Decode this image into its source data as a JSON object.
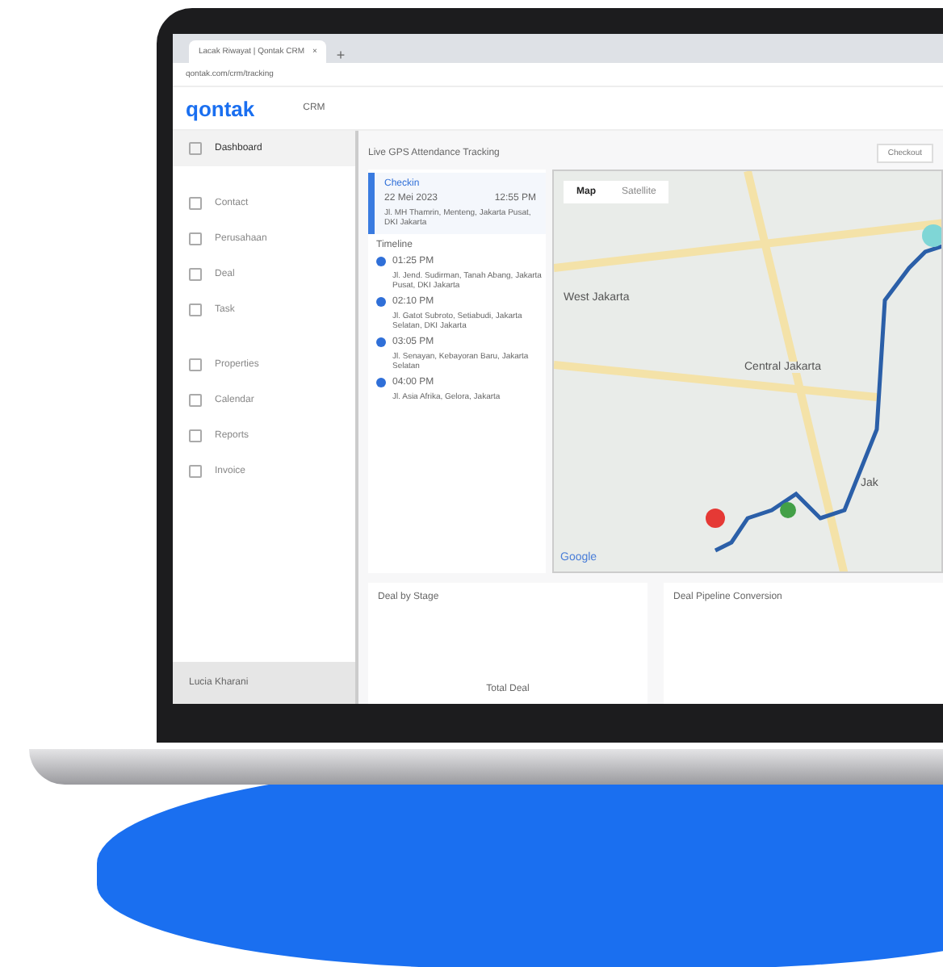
{
  "browser": {
    "tab_title": "Lacak Riwayat | Qontak CRM",
    "new_tab": "+",
    "close_tab": "×",
    "url": "qontak.com/crm/tracking"
  },
  "app": {
    "logo": "qontak",
    "module": "CRM"
  },
  "sidebar": {
    "items": [
      {
        "label": "Dashboard",
        "selected": true
      },
      {
        "label": "Contact",
        "selected": false
      },
      {
        "label": "Perusahaan",
        "selected": false
      },
      {
        "label": "Deal",
        "selected": false
      },
      {
        "label": "Task",
        "selected": false
      },
      {
        "label": "Properties",
        "selected": false
      },
      {
        "label": "Calendar",
        "selected": false
      },
      {
        "label": "Reports",
        "selected": false
      },
      {
        "label": "Invoice",
        "selected": false
      }
    ],
    "user": "Lucia Kharani"
  },
  "tracking": {
    "title": "Live GPS Attendance Tracking",
    "action": "Checkout",
    "checkin": {
      "label": "Checkin",
      "date": "22 Mei 2023",
      "time": "12:55 PM",
      "address": "Jl. MH Thamrin, Menteng, Jakarta Pusat, DKI Jakarta"
    },
    "timeline_label": "Timeline",
    "events": [
      {
        "time": "01:25 PM",
        "address": "Jl. Jend. Sudirman, Tanah Abang, Jakarta Pusat, DKI Jakarta"
      },
      {
        "time": "02:10 PM",
        "address": "Jl. Gatot Subroto, Setiabudi, Jakarta Selatan, DKI Jakarta"
      },
      {
        "time": "03:05 PM",
        "address": "Jl. Senayan, Kebayoran Baru, Jakarta Selatan"
      },
      {
        "time": "04:00 PM",
        "address": "Jl. Asia Afrika, Gelora, Jakarta"
      }
    ],
    "map": {
      "tabs": [
        {
          "label": "Map",
          "selected": true
        },
        {
          "label": "Satellite",
          "selected": false
        }
      ],
      "places": [
        "West Jakarta",
        "Central Jakarta",
        "Jak"
      ],
      "credit": "Google"
    }
  },
  "bottom": {
    "left_title": "Deal by Stage",
    "left_note": "Total Deal",
    "right_title": "Deal Pipeline Conversion"
  }
}
